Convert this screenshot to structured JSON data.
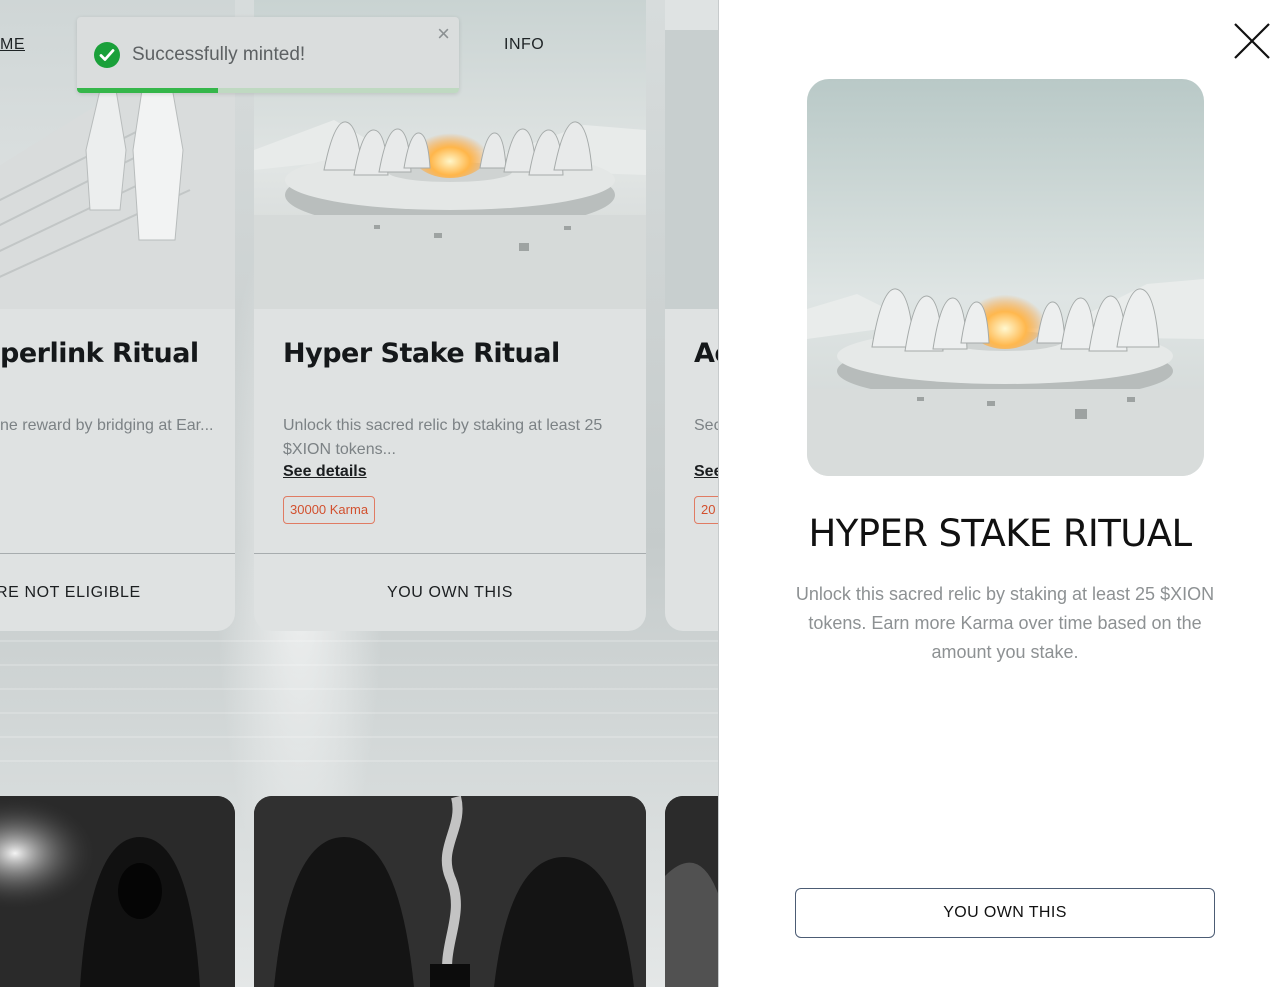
{
  "nav": {
    "home_label": "ME",
    "info_label": "INFO"
  },
  "toast": {
    "message": "Successfully minted!",
    "close_symbol": "×",
    "icon": "check-circle-icon",
    "success_color": "#1aa03a",
    "progress_fraction": 0.37
  },
  "cards": [
    {
      "title": "perlink Ritual",
      "description": "ne reward by bridging at Ear...",
      "action_label": "RE NOT ELIGIBLE"
    },
    {
      "title": "Hyper Stake Ritual",
      "description": "Unlock this sacred relic by staking at least 25 $XION tokens...",
      "link_label": "See details",
      "karma_badge": "30000 Karma",
      "action_label": "YOU OWN THIS"
    },
    {
      "title": "Ac",
      "description": "Sec an",
      "link_label": "See",
      "karma_badge": "20"
    }
  ],
  "panel": {
    "close_icon": "close-x-icon",
    "title": "HYPER STAKE RITUAL",
    "description": "Unlock this sacred relic by staking at least 25 $XION tokens. Earn more Karma over time based on the amount you stake.",
    "button_label": "YOU OWN THIS"
  },
  "colors": {
    "badge_accent": "#d2502e",
    "toast_progress": "#35b64a"
  }
}
